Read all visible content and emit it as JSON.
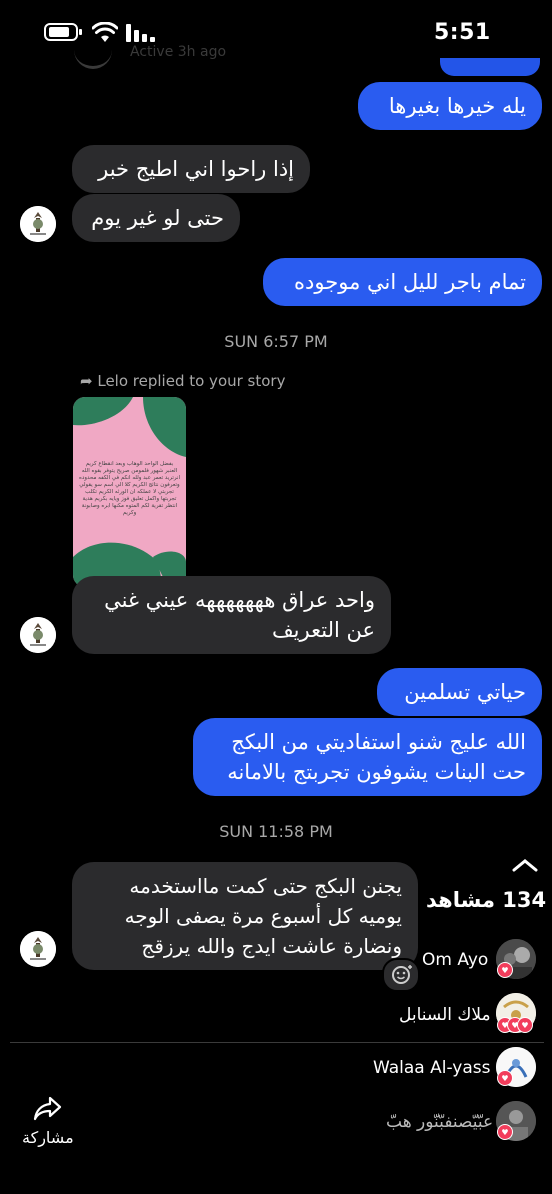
{
  "status_bar": {
    "time": "5:51"
  },
  "thread": {
    "ghost_status": "Active 3h ago",
    "messages_block1": {
      "out_1": "يله خيرها بغيرها",
      "in_1": "إذا راحوا اني اطيج خبر",
      "in_2": "حتى لو غير يوم",
      "out_2": "تمام باجر لليل اني موجوده"
    },
    "timestamp_1": "SUN 6:57 PM",
    "reply_note": "Lelo replied to your story",
    "story_text": "بفضل الواحد الوهاب وبعد انقطاع كريم العنبر شهور فلمومن صريح يتوفر بقوه الله انرتريد تعمر عبد ولله انكم في الكفه محدوده وتعرفون نتائج الكريم كلا الي اسم سو يقولي تجربتي لا عملكه ان الورثه الكريم تكلب تجربتها واكمل تعليق فوز ويايه بكريم هدية انتظر تقرية لكم المتوه مكنها ابره وصابونة وكريم",
    "messages_block2": {
      "in_3": "واحد عراق هههههههه عيني غني عن التعريف",
      "out_3": "حياتي تسلمين",
      "out_4": "الله عليج شنو استفاديتي من البكج حت البنات يشوفون تجربتج بالامانه"
    },
    "timestamp_2": "SUN 11:58 PM",
    "in_4": "يجنن البكج حتى كمت مااستخدمه يوميه كل أسبوع مرة يصفى الوجه ونضارة عاشت ايدج والله يرزقج"
  },
  "viewers_panel": {
    "views_label": "134 مشاهد",
    "viewers": [
      {
        "name": "Om Ayo"
      },
      {
        "name": "ملاك السنابل"
      },
      {
        "name": "Walaa Al-yass"
      },
      {
        "name": "عبّيّصنفبّنّور هبّ"
      }
    ],
    "share_label": "مشاركة"
  },
  "icons": {
    "battery": "battery-icon",
    "wifi": "wifi-icon",
    "signal": "signal-icon",
    "reply": "reply-arrow-icon",
    "chevron": "chevron-up-icon",
    "share": "share-icon",
    "heart": "heart-icon",
    "react": "react-emoji-icon"
  },
  "colors": {
    "outgoing": "#2a5cf0",
    "incoming": "#2b2b2d",
    "background": "#000000",
    "heart": "#f23d5c"
  }
}
